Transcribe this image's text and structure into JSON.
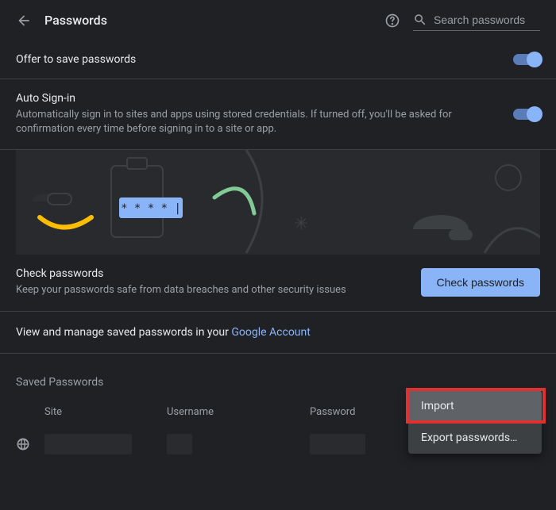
{
  "header": {
    "title": "Passwords",
    "search_placeholder": "Search passwords"
  },
  "offer_save": {
    "title": "Offer to save passwords",
    "enabled": true
  },
  "auto_signin": {
    "title": "Auto Sign-in",
    "description": "Automatically sign in to sites and apps using stored credentials. If turned off, you'll be asked for confirmation every time before signing in to a site or app.",
    "enabled": true
  },
  "check": {
    "title": "Check passwords",
    "description": "Keep your passwords safe from data breaches and other security issues",
    "button": "Check passwords"
  },
  "manage": {
    "prefix": "View and manage saved passwords in your ",
    "link": "Google Account"
  },
  "saved": {
    "heading": "Saved Passwords",
    "columns": {
      "site": "Site",
      "username": "Username",
      "password": "Password"
    }
  },
  "menu": {
    "import": "Import",
    "export": "Export passwords…"
  },
  "illustration": {
    "pass_mask": "* * * *"
  },
  "colors": {
    "accent": "#8ab4f8",
    "yellow": "#fbbc04",
    "green": "#81c995",
    "highlight": "#e03131"
  }
}
